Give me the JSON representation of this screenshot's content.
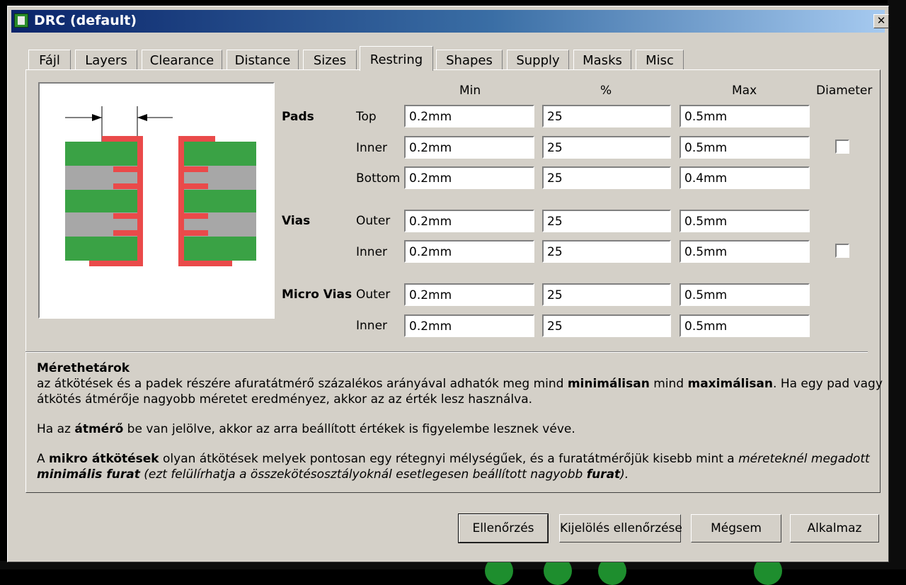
{
  "window": {
    "title": "DRC (default)",
    "close_glyph": "✕"
  },
  "tabs": [
    "Fájl",
    "Layers",
    "Clearance",
    "Distance",
    "Sizes",
    "Restring",
    "Shapes",
    "Supply",
    "Masks",
    "Misc"
  ],
  "active_tab": "Restring",
  "columns": {
    "min": "Min",
    "percent": "%",
    "max": "Max",
    "diameter": "Diameter"
  },
  "groups": {
    "pads": {
      "label": "Pads",
      "rows": [
        {
          "label": "Top",
          "min": "0.2mm",
          "percent": "25",
          "max": "0.5mm"
        },
        {
          "label": "Inner",
          "min": "0.2mm",
          "percent": "25",
          "max": "0.5mm"
        },
        {
          "label": "Bottom",
          "min": "0.2mm",
          "percent": "25",
          "max": "0.4mm"
        }
      ],
      "diameter_checked": false
    },
    "vias": {
      "label": "Vias",
      "rows": [
        {
          "label": "Outer",
          "min": "0.2mm",
          "percent": "25",
          "max": "0.5mm"
        },
        {
          "label": "Inner",
          "min": "0.2mm",
          "percent": "25",
          "max": "0.5mm"
        }
      ],
      "diameter_checked": false
    },
    "micro_vias": {
      "label": "Micro Vias",
      "rows": [
        {
          "label": "Outer",
          "min": "0.2mm",
          "percent": "25",
          "max": "0.5mm"
        },
        {
          "label": "Inner",
          "min": "0.2mm",
          "percent": "25",
          "max": "0.5mm"
        }
      ]
    }
  },
  "info": {
    "heading": "Mérethetárok",
    "p1a": "az átkötések és a padek részére afuratátmérő százalékos arányával adhatók meg mind ",
    "p1b": "minimálisan",
    "p1c": " mind ",
    "p1d": "maximálisan",
    "p1e": ". Ha egy pad vagy",
    "p1f": "átkötés átmérője nagyobb méretet eredményez, akkor az az érték lesz használva.",
    "p2a": "Ha az ",
    "p2b": "átmérő",
    "p2c": " be van jelölve, akkor az arra beállított értékek is figyelembe lesznek véve.",
    "p3a": "A ",
    "p3b": "mikro átkötések",
    "p3c": " olyan átkötések melyek pontosan egy rétegnyi mélységűek, és a furatátmérőjük kisebb mint a ",
    "p3d": "méreteknél megadott",
    "p3e": "minimális furat",
    "p3f": " (ezt felülírhatja a összekötésosztályoknál esetlegesen beállított nagyobb ",
    "p3g": "furat",
    "p3h": ")."
  },
  "buttons": {
    "check": "Ellenőrzés",
    "check_selection": "Kijelölés ellenőrzése",
    "cancel": "Mégsem",
    "apply": "Alkalmaz"
  },
  "colors": {
    "pad_green": "#3aa245",
    "restring_red": "#ea4a4a",
    "via_gray": "#a7a7a7",
    "title_start": "#0a246a",
    "title_end": "#a6caf0"
  }
}
